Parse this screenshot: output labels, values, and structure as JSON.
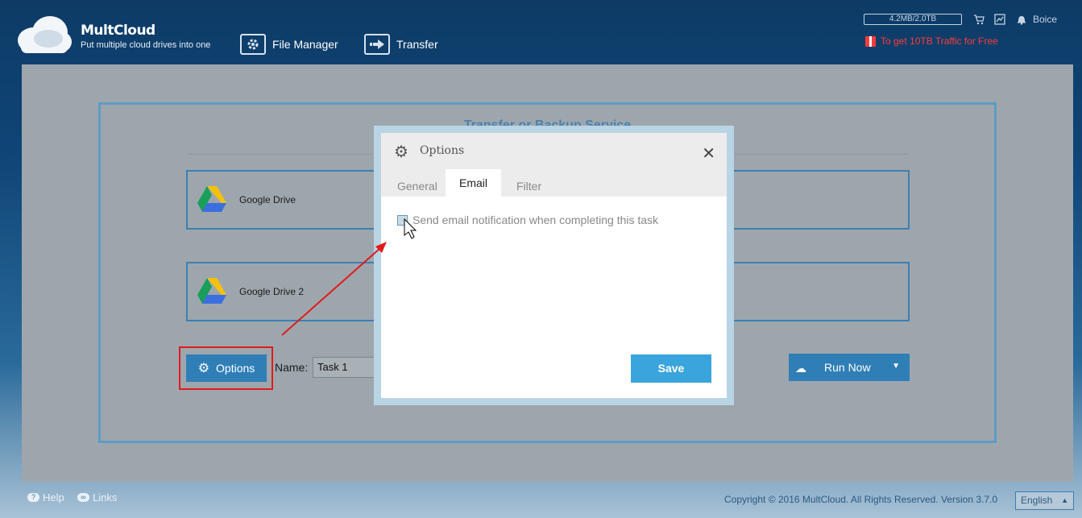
{
  "header": {
    "brand": "MultCloud",
    "tagline": "Put multiple cloud drives into one",
    "nav": [
      {
        "label": "File Manager",
        "icon": "gear-icon"
      },
      {
        "label": "Transfer",
        "icon": "arrow-right-icon"
      }
    ],
    "traffic": "4.2MB/2.0TB",
    "username": "Boice",
    "promo": "To get 10TB Traffic for Free"
  },
  "main": {
    "service_title": "Transfer or Backup Service",
    "source": "Google Drive",
    "destination": "Google Drive 2",
    "options_label": "Options",
    "name_label": "Name:",
    "task_name": "Task 1",
    "run_label": "Run Now"
  },
  "dialog": {
    "title": "Options",
    "close": "✕",
    "tabs": [
      "General",
      "Email",
      "Filter"
    ],
    "active_tab": "Email",
    "email_checkbox_label": "Send email notification when completing this task",
    "save_label": "Save"
  },
  "footer": {
    "help": "Help",
    "links": "Links",
    "copyright": "Copyright © 2016 MultCloud. All Rights Reserved. Version 3.7.0",
    "language": "English"
  },
  "colors": {
    "accent": "#2f7fb6",
    "save": "#3aa4dc",
    "highlight": "#e01b1b",
    "promo": "#ff3b3b"
  }
}
